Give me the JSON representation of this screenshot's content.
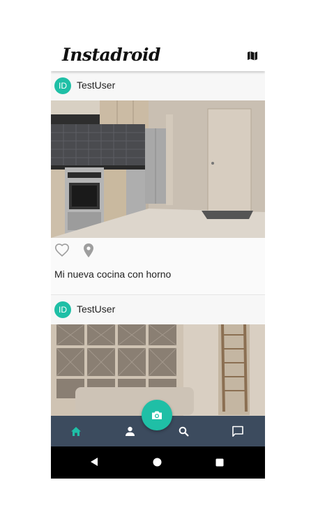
{
  "appbar": {
    "title": "Instadroid",
    "map_icon": "map-icon"
  },
  "posts": [
    {
      "avatar_initials": "ID",
      "username": "TestUser",
      "caption": "Mi nueva cocina con horno",
      "image": "kitchen-photo"
    },
    {
      "avatar_initials": "ID",
      "username": "TestUser",
      "caption": "",
      "image": "living-room-photo"
    }
  ],
  "post_actions": {
    "like_icon": "heart-outline-icon",
    "location_icon": "location-pin-icon"
  },
  "bottom_nav": {
    "items": [
      {
        "icon": "home-icon",
        "active": true
      },
      {
        "icon": "person-icon",
        "active": false
      },
      {
        "icon": "search-icon",
        "active": false
      },
      {
        "icon": "chat-icon",
        "active": false
      }
    ],
    "fab_icon": "camera-icon"
  },
  "system_nav": {
    "back": "back-icon",
    "home": "home-circle-icon",
    "recents": "recents-icon"
  },
  "colors": {
    "accent": "#1fbfa6",
    "nav_bg": "#3c4b5e",
    "icon_gray": "#9e9e9e"
  }
}
